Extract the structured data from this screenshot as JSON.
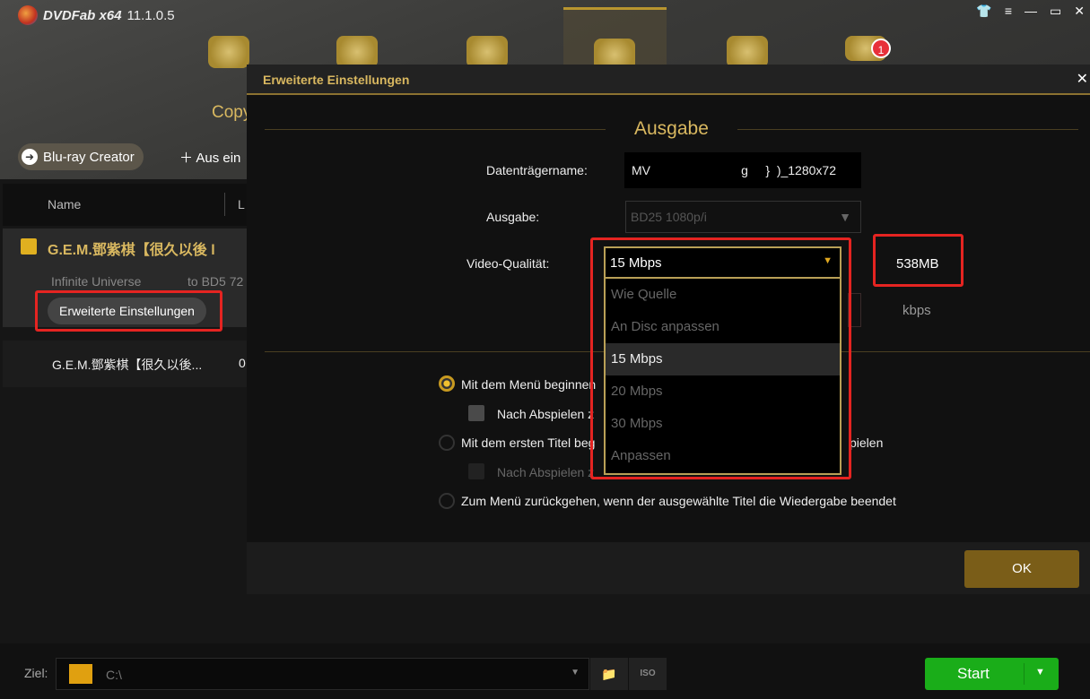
{
  "app": {
    "brand": "DVDFab x64",
    "version": "11.1.0.5",
    "notification_count": "1",
    "copy_label": "Copy",
    "creator_label": "Blu-ray Creator",
    "add_label": "Aus ein"
  },
  "list": {
    "col_name": "Name",
    "col_2": "L",
    "task_title": "G.E.M.鄧紫棋【很久以後 l",
    "task_source": "Infinite Universe",
    "task_target": "to BD5 72",
    "advanced_button": "Erweiterte Einstellungen",
    "sub_title": "G.E.M.鄧紫棋【很久以後...",
    "sub_value": "0"
  },
  "dialog": {
    "title": "Erweiterte Einstellungen",
    "section": "Ausgabe",
    "disc_name_label": "Datenträgername:",
    "disc_name_value": "MV                          g     }  )_1280x72",
    "output_label": "Ausgabe:",
    "output_value": "BD25 1080p/i",
    "quality_label": "Video-Qualität:",
    "quality_value": "15 Mbps",
    "size": "538MB",
    "kbps": "kbps",
    "quality_options": [
      "Wie Quelle",
      "An Disc anpassen",
      "15 Mbps",
      "20 Mbps",
      "30 Mbps",
      "Anpassen"
    ],
    "opt1": "Mit dem Menü beginnen",
    "opt1_sub": "Nach Abspielen z",
    "opt2": "Mit dem ersten Titel beg",
    "opt2_end": "pielen",
    "opt2_sub": "Nach Abspielen z",
    "opt3": "Zum Menü zurückgehen, wenn der ausgewählte Titel die Wiedergabe beendet",
    "ok": "OK"
  },
  "footer": {
    "target_label": "Ziel:",
    "target_value": "C:\\",
    "start": "Start"
  },
  "colors": {
    "gold": "#d9b860",
    "green": "#1aad19",
    "red": "#e52421"
  }
}
